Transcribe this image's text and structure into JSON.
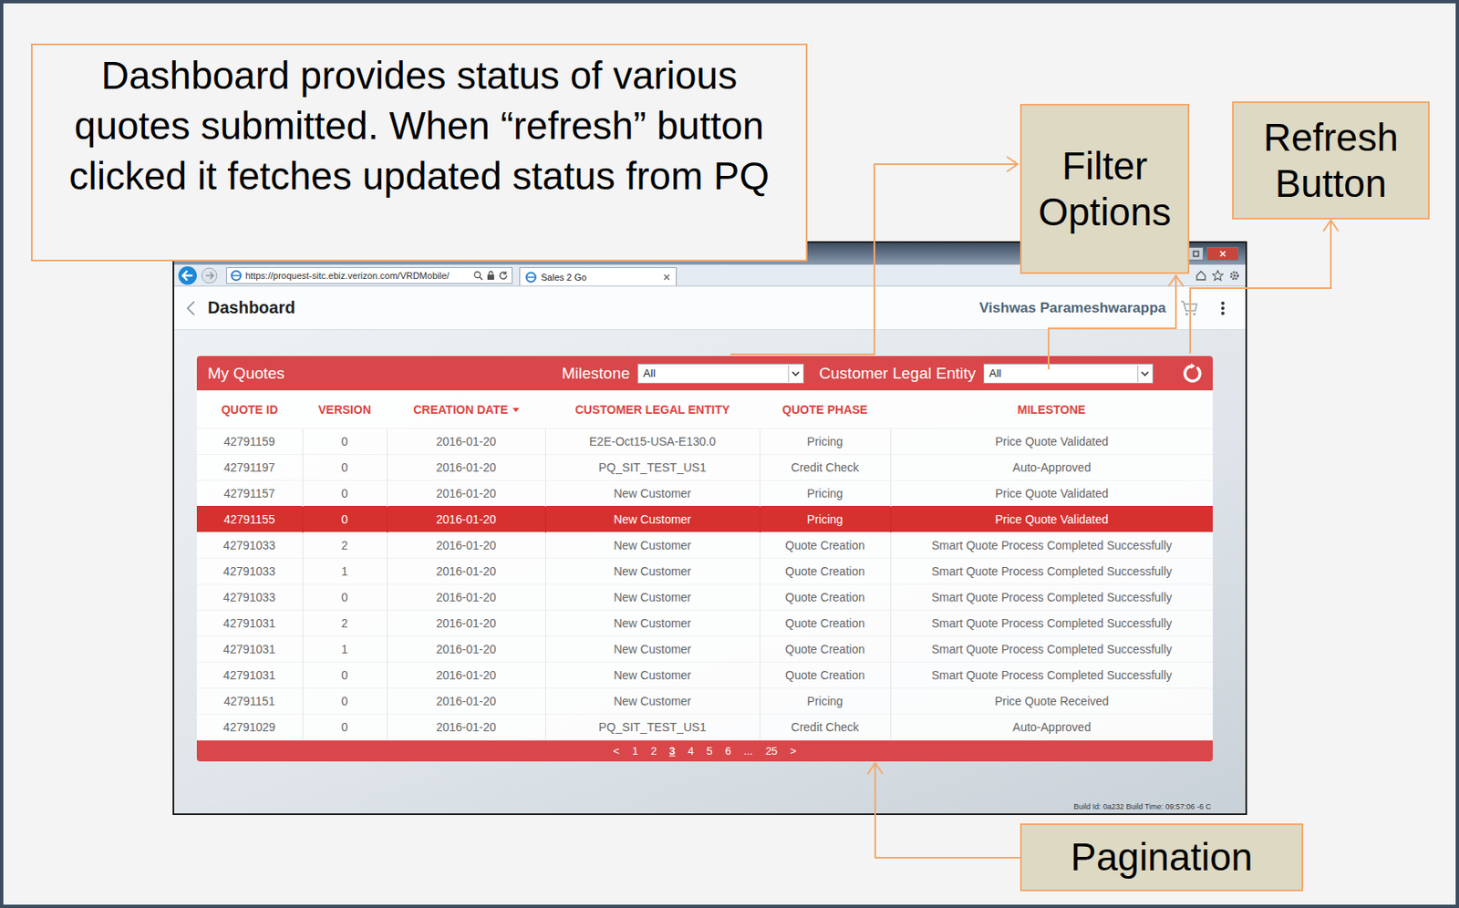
{
  "callouts": {
    "description": "Dashboard provides status of various quotes submitted. When “refresh” button clicked it fetches updated status from PQ",
    "filter": "Filter Options",
    "refresh": "Refresh Button",
    "pagination": "Pagination"
  },
  "browser": {
    "url": "https://proquest-sitc.ebiz.verizon.com/VRDMobile/",
    "tab": "Sales 2 Go"
  },
  "app": {
    "title": "Dashboard",
    "user": "Vishwas Parameshwarappa"
  },
  "panel": {
    "title": "My Quotes",
    "filters": [
      {
        "label": "Milestone",
        "value": "All"
      },
      {
        "label": "Customer Legal Entity",
        "value": "All"
      }
    ]
  },
  "table": {
    "columns": [
      {
        "label": "QUOTE ID",
        "sorted": false
      },
      {
        "label": "VERSION",
        "sorted": false
      },
      {
        "label": "CREATION DATE",
        "sorted": true
      },
      {
        "label": "CUSTOMER LEGAL ENTITY",
        "sorted": false
      },
      {
        "label": "QUOTE PHASE",
        "sorted": false
      },
      {
        "label": "MILESTONE",
        "sorted": false
      }
    ],
    "rows": [
      {
        "cells": [
          "42791159",
          "0",
          "2016-01-20",
          "E2E-Oct15-USA-E130.0",
          "Pricing",
          "Price Quote Validated"
        ],
        "selected": false
      },
      {
        "cells": [
          "42791197",
          "0",
          "2016-01-20",
          "PQ_SIT_TEST_US1",
          "Credit Check",
          "Auto-Approved"
        ],
        "selected": false
      },
      {
        "cells": [
          "42791157",
          "0",
          "2016-01-20",
          "New Customer",
          "Pricing",
          "Price Quote Validated"
        ],
        "selected": false
      },
      {
        "cells": [
          "42791155",
          "0",
          "2016-01-20",
          "New Customer",
          "Pricing",
          "Price Quote Validated"
        ],
        "selected": true
      },
      {
        "cells": [
          "42791033",
          "2",
          "2016-01-20",
          "New Customer",
          "Quote Creation",
          "Smart Quote Process Completed Successfully"
        ],
        "selected": false
      },
      {
        "cells": [
          "42791033",
          "1",
          "2016-01-20",
          "New Customer",
          "Quote Creation",
          "Smart Quote Process Completed Successfully"
        ],
        "selected": false
      },
      {
        "cells": [
          "42791033",
          "0",
          "2016-01-20",
          "New Customer",
          "Quote Creation",
          "Smart Quote Process Completed Successfully"
        ],
        "selected": false
      },
      {
        "cells": [
          "42791031",
          "2",
          "2016-01-20",
          "New Customer",
          "Quote Creation",
          "Smart Quote Process Completed Successfully"
        ],
        "selected": false
      },
      {
        "cells": [
          "42791031",
          "1",
          "2016-01-20",
          "New Customer",
          "Quote Creation",
          "Smart Quote Process Completed Successfully"
        ],
        "selected": false
      },
      {
        "cells": [
          "42791031",
          "0",
          "2016-01-20",
          "New Customer",
          "Quote Creation",
          "Smart Quote Process Completed Successfully"
        ],
        "selected": false
      },
      {
        "cells": [
          "42791151",
          "0",
          "2016-01-20",
          "New Customer",
          "Pricing",
          "Price Quote Received"
        ],
        "selected": false
      },
      {
        "cells": [
          "42791029",
          "0",
          "2016-01-20",
          "PQ_SIT_TEST_US1",
          "Credit Check",
          "Auto-Approved"
        ],
        "selected": false
      }
    ]
  },
  "pagination": {
    "prev": "<",
    "next": ">",
    "pages": [
      {
        "label": "1",
        "selected": false
      },
      {
        "label": "2",
        "selected": false
      },
      {
        "label": "3",
        "selected": true
      },
      {
        "label": "4",
        "selected": false
      },
      {
        "label": "5",
        "selected": false
      },
      {
        "label": "6",
        "selected": false
      },
      {
        "label": "...",
        "selected": false
      },
      {
        "label": "25",
        "selected": false
      }
    ]
  },
  "build": "Build Id: 0a232 Build Time: 09:57:06 -6 C"
}
